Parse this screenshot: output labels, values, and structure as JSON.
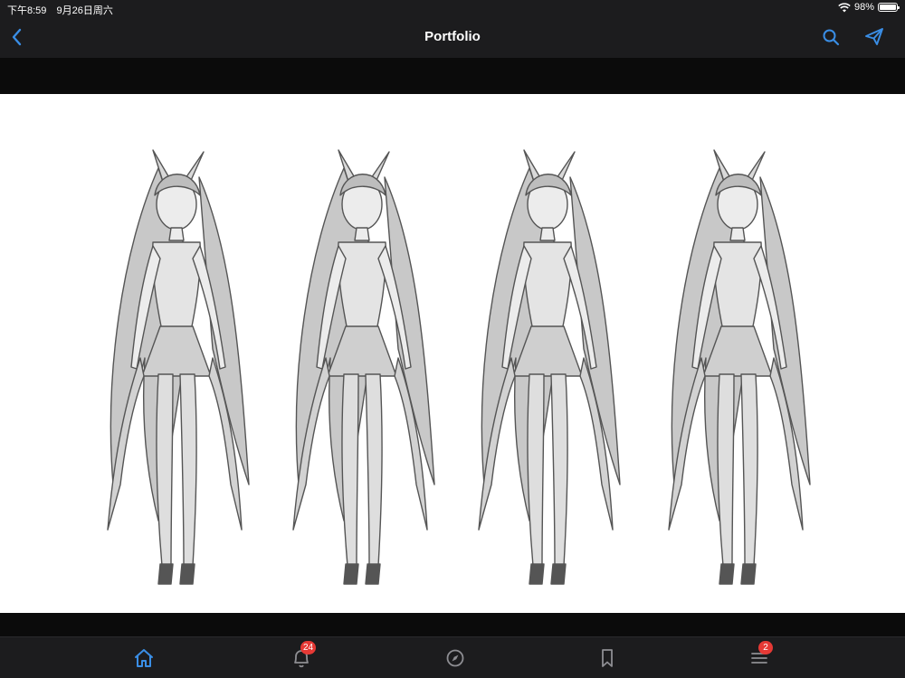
{
  "status_bar": {
    "time": "下午8:59",
    "date": "9月26日周六",
    "battery_percent": "98%",
    "battery_level": 0.98
  },
  "nav": {
    "title": "Portfolio",
    "back_icon": "chevron-left-icon",
    "search_icon": "search-icon",
    "share_icon": "paper-plane-icon"
  },
  "artwork": {
    "description_icon": "sketch-artwork",
    "figure_count": 4
  },
  "tab_bar": {
    "items": [
      {
        "icon": "home-icon",
        "active": true,
        "badge": ""
      },
      {
        "icon": "bell-icon",
        "active": false,
        "badge": "24"
      },
      {
        "icon": "compass-icon",
        "active": false,
        "badge": ""
      },
      {
        "icon": "bookmark-icon",
        "active": false,
        "badge": ""
      },
      {
        "icon": "menu-icon",
        "active": false,
        "badge": "2"
      }
    ]
  },
  "colors": {
    "accent": "#3a8ee6",
    "bar_bg": "#1c1c1e",
    "badge": "#e53935"
  }
}
